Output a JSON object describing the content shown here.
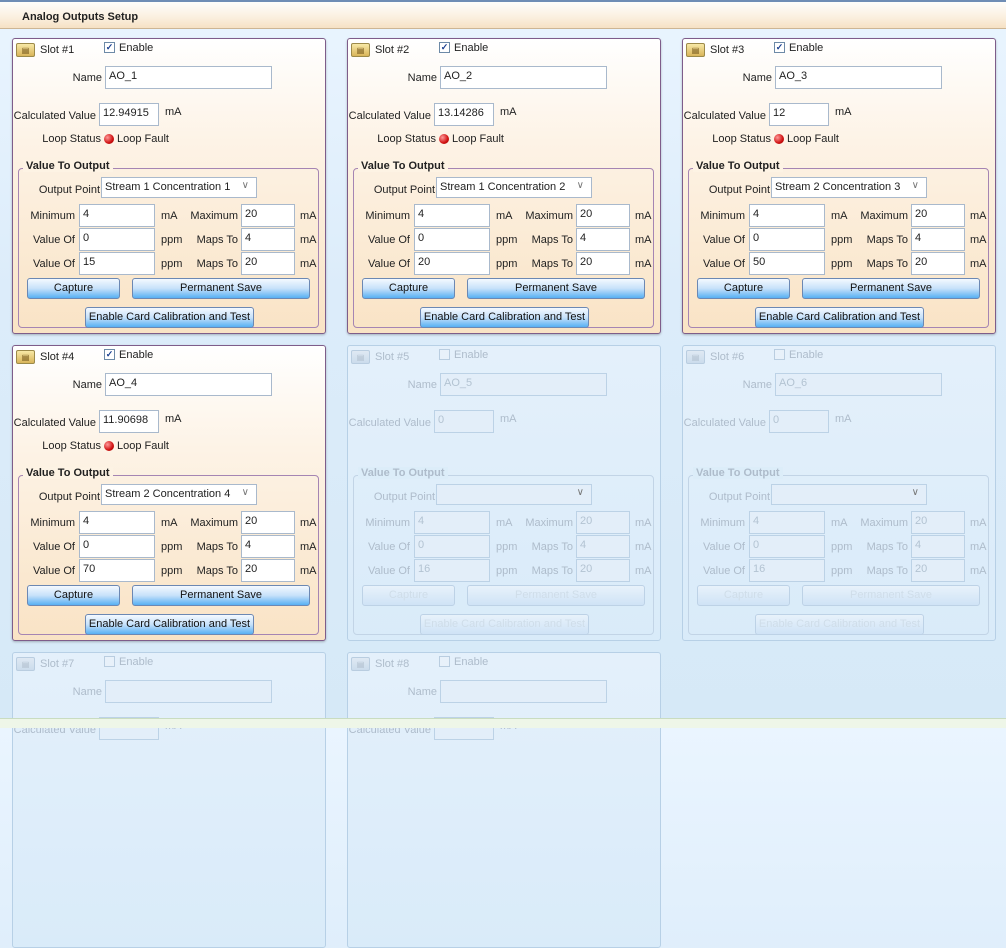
{
  "header": {
    "title": "Analog Outputs Setup"
  },
  "labels": {
    "enable": "Enable",
    "name": "Name",
    "calculated_value": "Calculated Value",
    "loop_status": "Loop Status",
    "value_to_output": "Value To Output",
    "output_point": "Output Point",
    "minimum": "Minimum",
    "maximum": "Maximum",
    "value_of": "Value Of",
    "maps_to": "Maps To",
    "ma": "mA",
    "ppm": "ppm",
    "capture": "Capture",
    "permanent_save": "Permanent Save",
    "enable_calibration": "Enable Card Calibration and Test"
  },
  "slots": [
    {
      "title": "Slot #1",
      "enabled": true,
      "name": "AO_1",
      "calculated_value": "12.94915",
      "loop_status": "Loop Fault",
      "output_point": "Stream 1 Concentration 1",
      "minimum": "4",
      "maximum": "20",
      "value_of_1": "0",
      "maps_to_1": "4",
      "value_of_2": "15",
      "maps_to_2": "20"
    },
    {
      "title": "Slot #2",
      "enabled": true,
      "name": "AO_2",
      "calculated_value": "13.14286",
      "loop_status": "Loop Fault",
      "output_point": "Stream 1 Concentration 2",
      "minimum": "4",
      "maximum": "20",
      "value_of_1": "0",
      "maps_to_1": "4",
      "value_of_2": "20",
      "maps_to_2": "20"
    },
    {
      "title": "Slot #3",
      "enabled": true,
      "name": "AO_3",
      "calculated_value": "12",
      "loop_status": "Loop Fault",
      "output_point": "Stream 2 Concentration 3",
      "minimum": "4",
      "maximum": "20",
      "value_of_1": "0",
      "maps_to_1": "4",
      "value_of_2": "50",
      "maps_to_2": "20"
    },
    {
      "title": "Slot #4",
      "enabled": true,
      "name": "AO_4",
      "calculated_value": "11.90698",
      "loop_status": "Loop Fault",
      "output_point": "Stream 2 Concentration 4",
      "minimum": "4",
      "maximum": "20",
      "value_of_1": "0",
      "maps_to_1": "4",
      "value_of_2": "70",
      "maps_to_2": "20"
    },
    {
      "title": "Slot #5",
      "enabled": false,
      "name": "AO_5",
      "calculated_value": "0",
      "loop_status": "",
      "output_point": "",
      "minimum": "4",
      "maximum": "20",
      "value_of_1": "0",
      "maps_to_1": "4",
      "value_of_2": "16",
      "maps_to_2": "20"
    },
    {
      "title": "Slot #6",
      "enabled": false,
      "name": "AO_6",
      "calculated_value": "0",
      "loop_status": "",
      "output_point": "",
      "minimum": "4",
      "maximum": "20",
      "value_of_1": "0",
      "maps_to_1": "4",
      "value_of_2": "16",
      "maps_to_2": "20"
    },
    {
      "title": "Slot #7",
      "enabled": false,
      "name": "",
      "calculated_value": "",
      "loop_status": "",
      "output_point": "",
      "minimum": "",
      "maximum": "",
      "value_of_1": "",
      "maps_to_1": "",
      "value_of_2": "",
      "maps_to_2": ""
    },
    {
      "title": "Slot #8",
      "enabled": false,
      "name": "",
      "calculated_value": "",
      "loop_status": "",
      "output_point": "",
      "minimum": "",
      "maximum": "",
      "value_of_1": "",
      "maps_to_1": "",
      "value_of_2": "",
      "maps_to_2": ""
    }
  ],
  "colors": {
    "loop_fault_led": "#d01010",
    "panel_border": "#7e5d8a",
    "button_blue": "#57b0f3"
  },
  "icons": {
    "slot": "card-module-icon",
    "dropdown": "chevron-down-icon",
    "status": "red-led-icon"
  }
}
